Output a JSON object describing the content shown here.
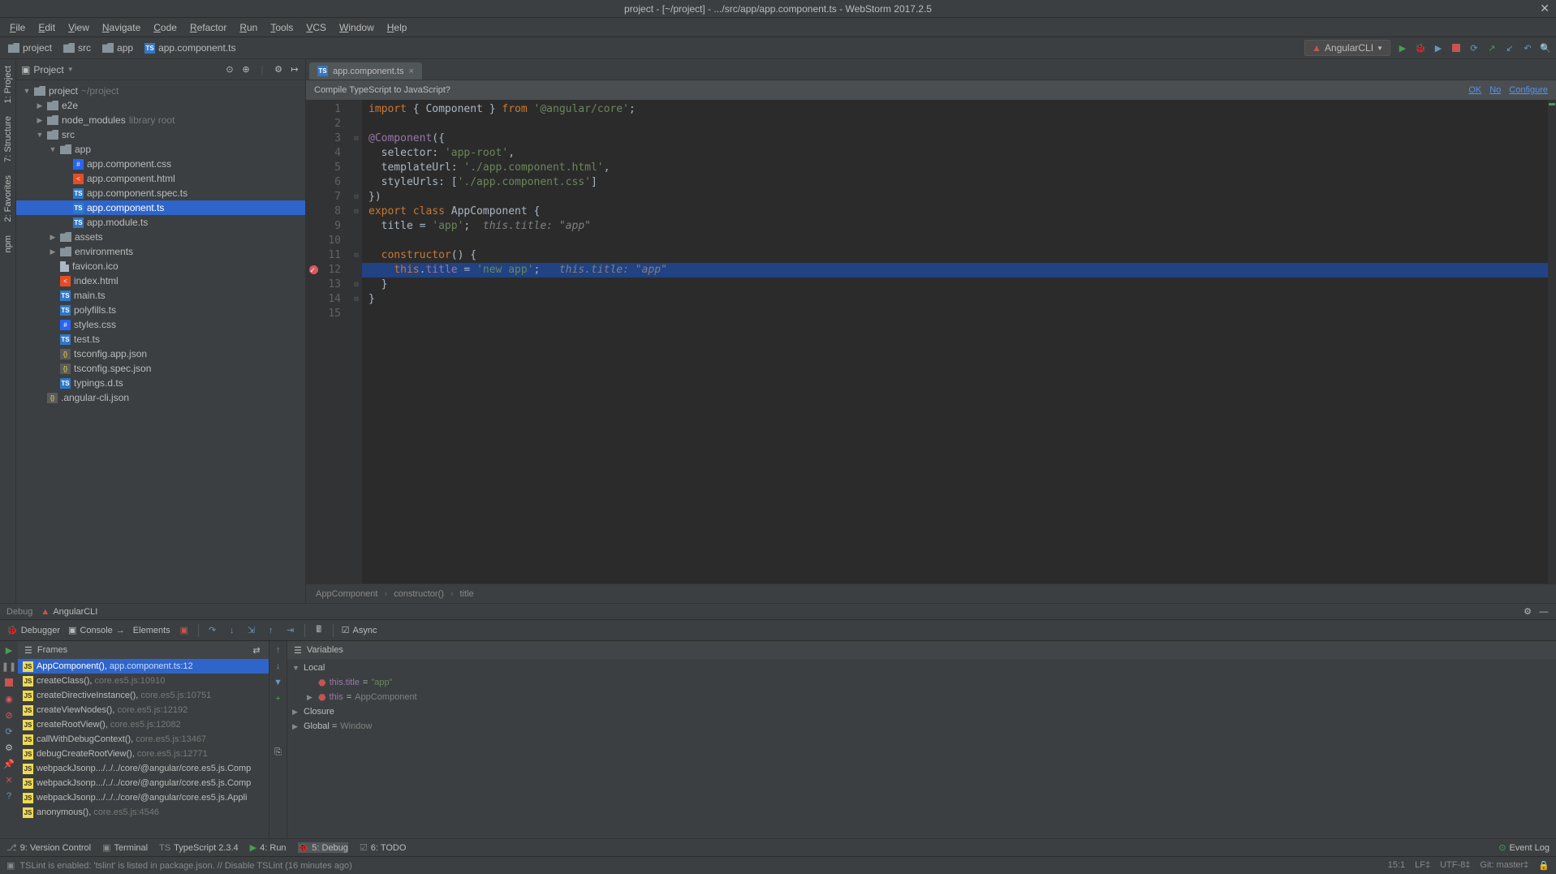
{
  "title": "project - [~/project] - .../src/app/app.component.ts - WebStorm 2017.2.5",
  "menu": [
    "File",
    "Edit",
    "View",
    "Navigate",
    "Code",
    "Refactor",
    "Run",
    "Tools",
    "VCS",
    "Window",
    "Help"
  ],
  "crumbs": [
    {
      "icon": "folder",
      "text": "project"
    },
    {
      "icon": "folder",
      "text": "src"
    },
    {
      "icon": "folder",
      "text": "app"
    },
    {
      "icon": "ts",
      "text": "app.component.ts"
    }
  ],
  "runConfig": "AngularCLI",
  "projectPane": {
    "title": "Project"
  },
  "leftTabs": [
    "1: Project",
    "7: Structure",
    "2: Favorites",
    "npm"
  ],
  "tree": [
    {
      "d": 0,
      "a": "▼",
      "i": "folder",
      "t": "project",
      "dim": "~/project"
    },
    {
      "d": 1,
      "a": "▶",
      "i": "folder",
      "t": "e2e"
    },
    {
      "d": 1,
      "a": "▶",
      "i": "folder",
      "t": "node_modules",
      "dim": "library root"
    },
    {
      "d": 1,
      "a": "▼",
      "i": "folder",
      "t": "src"
    },
    {
      "d": 2,
      "a": "▼",
      "i": "folder",
      "t": "app"
    },
    {
      "d": 3,
      "a": "",
      "i": "css",
      "t": "app.component.css"
    },
    {
      "d": 3,
      "a": "",
      "i": "html",
      "t": "app.component.html"
    },
    {
      "d": 3,
      "a": "",
      "i": "ts",
      "t": "app.component.spec.ts"
    },
    {
      "d": 3,
      "a": "",
      "i": "ts",
      "t": "app.component.ts",
      "sel": true
    },
    {
      "d": 3,
      "a": "",
      "i": "ts",
      "t": "app.module.ts"
    },
    {
      "d": 2,
      "a": "▶",
      "i": "folder",
      "t": "assets"
    },
    {
      "d": 2,
      "a": "▶",
      "i": "folder",
      "t": "environments"
    },
    {
      "d": 2,
      "a": "",
      "i": "file",
      "t": "favicon.ico"
    },
    {
      "d": 2,
      "a": "",
      "i": "html",
      "t": "index.html"
    },
    {
      "d": 2,
      "a": "",
      "i": "ts",
      "t": "main.ts"
    },
    {
      "d": 2,
      "a": "",
      "i": "ts",
      "t": "polyfills.ts"
    },
    {
      "d": 2,
      "a": "",
      "i": "css",
      "t": "styles.css"
    },
    {
      "d": 2,
      "a": "",
      "i": "ts",
      "t": "test.ts"
    },
    {
      "d": 2,
      "a": "",
      "i": "json",
      "t": "tsconfig.app.json"
    },
    {
      "d": 2,
      "a": "",
      "i": "json",
      "t": "tsconfig.spec.json"
    },
    {
      "d": 2,
      "a": "",
      "i": "ts",
      "t": "typings.d.ts"
    },
    {
      "d": 1,
      "a": "",
      "i": "json",
      "t": ".angular-cli.json"
    }
  ],
  "tab": {
    "name": "app.component.ts"
  },
  "banner": {
    "msg": "Compile TypeScript to JavaScript?",
    "ok": "OK",
    "no": "No",
    "cfg": "Configure"
  },
  "code": {
    "lines": [
      {
        "n": 1,
        "html": "<span class='kw'>import</span> { Component } <span class='kw'>from</span> <span class='str'>'@angular/core'</span>;"
      },
      {
        "n": 2,
        "html": ""
      },
      {
        "n": 3,
        "html": "<span class='prop'>@Component</span>({"
      },
      {
        "n": 4,
        "html": "  selector: <span class='str'>'app-root'</span>,"
      },
      {
        "n": 5,
        "html": "  templateUrl: <span class='str'>'./app.component.html'</span>,"
      },
      {
        "n": 6,
        "html": "  styleUrls: [<span class='str'>'./app.component.css'</span>]"
      },
      {
        "n": 7,
        "html": "})"
      },
      {
        "n": 8,
        "html": "<span class='kw'>export class</span> <span class='cls'>AppComponent</span> {"
      },
      {
        "n": 9,
        "html": "  title = <span class='str'>'app'</span>;  <span class='cmt'>this.title: \"app\"</span>"
      },
      {
        "n": 10,
        "html": ""
      },
      {
        "n": 11,
        "html": "  <span class='kw'>constructor</span>() {"
      },
      {
        "n": 12,
        "html": "    <span class='kw'>this</span>.<span class='prop'>title</span> = <span class='str'>'new app'</span>;   <span class='cmt'>this.title: \"app\"</span>",
        "hl": true,
        "bp": true
      },
      {
        "n": 13,
        "html": "  }"
      },
      {
        "n": 14,
        "html": "}"
      },
      {
        "n": 15,
        "html": ""
      }
    ]
  },
  "breadcrumb": [
    "AppComponent",
    "constructor()",
    "title"
  ],
  "debug": {
    "tabLabel": "Debug",
    "config": "AngularCLI",
    "tabs": [
      "Debugger",
      "Console",
      "Elements"
    ],
    "async": "Async",
    "framesTitle": "Frames",
    "varsTitle": "Variables",
    "frames": [
      {
        "t": "AppComponent()",
        "l": "app.component.ts:12",
        "sel": true
      },
      {
        "t": "createClass()",
        "l": "core.es5.js:10910"
      },
      {
        "t": "createDirectiveInstance()",
        "l": "core.es5.js:10751"
      },
      {
        "t": "createViewNodes()",
        "l": "core.es5.js:12192"
      },
      {
        "t": "createRootView()",
        "l": "core.es5.js:12082"
      },
      {
        "t": "callWithDebugContext()",
        "l": "core.es5.js:13467"
      },
      {
        "t": "debugCreateRootView()",
        "l": "core.es5.js:12771"
      },
      {
        "t": "webpackJsonp.../../../core/@angular/core.es5.js.Comp",
        "l": ""
      },
      {
        "t": "webpackJsonp.../../../core/@angular/core.es5.js.Comp",
        "l": ""
      },
      {
        "t": "webpackJsonp.../../../core/@angular/core.es5.js.Appli",
        "l": ""
      },
      {
        "t": "anonymous()",
        "l": "core.es5.js:4546"
      }
    ],
    "vars": [
      {
        "d": 0,
        "a": "▼",
        "t": "Local"
      },
      {
        "d": 1,
        "a": "",
        "n": "this.title",
        "eq": " = ",
        "v": "\"app\"",
        "cls": "str"
      },
      {
        "d": 1,
        "a": "▶",
        "n": "this",
        "eq": " = ",
        "v": "AppComponent",
        "cls": "type"
      },
      {
        "d": 0,
        "a": "▶",
        "t": "Closure"
      },
      {
        "d": 0,
        "a": "▶",
        "t": "Global = ",
        "v": "Window",
        "cls": "type"
      }
    ]
  },
  "bottombar": {
    "items": [
      {
        "i": "vcs",
        "t": "9: Version Control"
      },
      {
        "i": "term",
        "t": "Terminal"
      },
      {
        "i": "ts",
        "t": "TypeScript 2.3.4"
      },
      {
        "i": "run",
        "t": "4: Run"
      },
      {
        "i": "debug",
        "t": "5: Debug",
        "active": true
      },
      {
        "i": "todo",
        "t": "6: TODO"
      }
    ],
    "eventlog": "Event Log"
  },
  "status": {
    "msg": "TSLint is enabled: 'tslint' is listed in package.json. // Disable TSLint (16 minutes ago)",
    "right": [
      "15:1",
      "LF‡",
      "UTF-8‡",
      "Git: master‡"
    ]
  }
}
